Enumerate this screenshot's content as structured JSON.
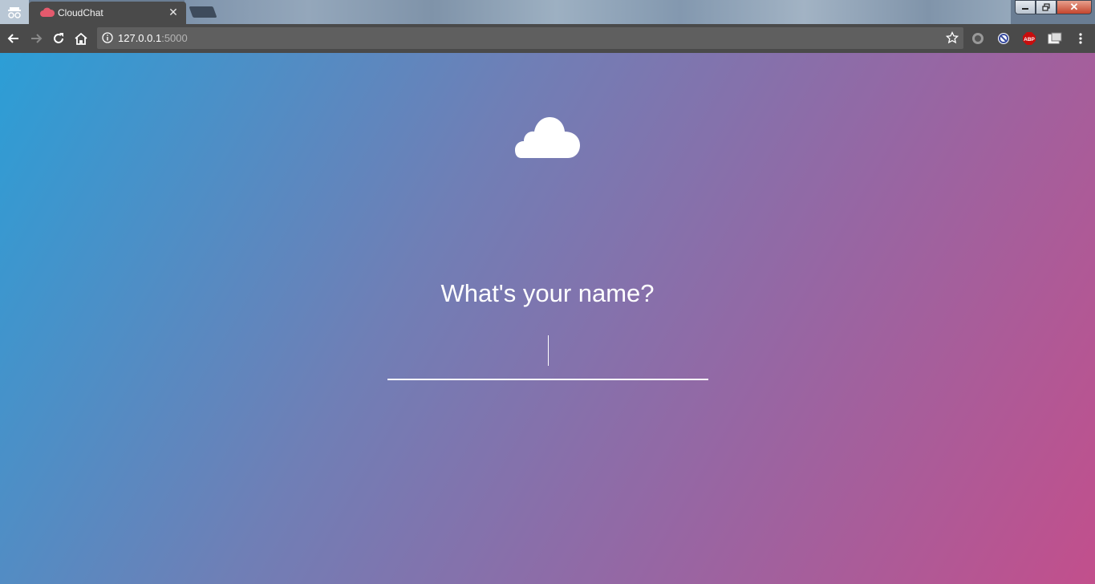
{
  "browser": {
    "tab": {
      "title": "CloudChat"
    },
    "address": {
      "host": "127.0.0.1",
      "port": ":5000"
    }
  },
  "icons": [
    "incognito-icon",
    "cloud-favicon-icon",
    "close-icon",
    "back-icon",
    "forward-icon",
    "reload-icon",
    "home-icon",
    "info-icon",
    "star-icon",
    "extension-circle-icon",
    "block-icon",
    "adblock-icon",
    "extension-card-icon",
    "menu-icon",
    "cloud-icon"
  ],
  "colors": {
    "gradient_start": "#2c9ed6",
    "gradient_mid": "#8c6ea8",
    "gradient_end": "#c24f8c",
    "favicon": "#e45a6d"
  },
  "main": {
    "prompt": "What's your name?",
    "name_input": {
      "value": ""
    }
  },
  "extensions": {
    "adblock_label": "ABP"
  }
}
